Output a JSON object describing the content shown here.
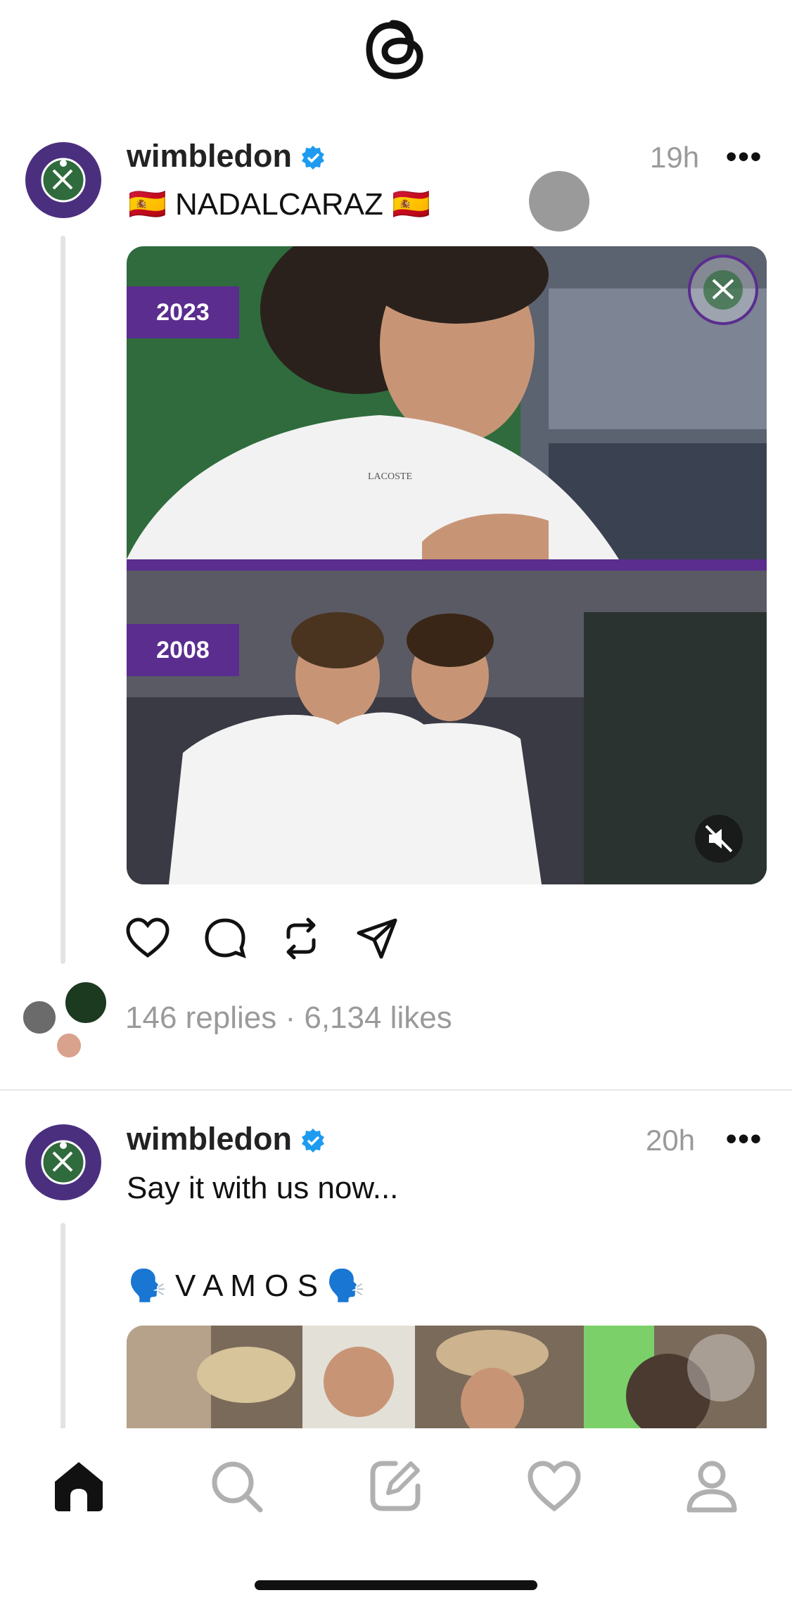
{
  "app": {
    "logo_icon": "threads-logo-icon"
  },
  "posts": [
    {
      "username": "wimbledon",
      "verified": true,
      "time": "19h",
      "more_label": "•••",
      "caption": "🇪🇸 NADALCARAZ 🇪🇸",
      "media": {
        "badge_top": "2023",
        "badge_bottom": "2008",
        "logo_text": "LACOSTE",
        "mute_icon": "speaker-muted-icon"
      },
      "stats": "146 replies · 6,134 likes",
      "actions": [
        "like-icon",
        "comment-icon",
        "repost-icon",
        "share-icon"
      ]
    },
    {
      "username": "wimbledon",
      "verified": true,
      "time": "20h",
      "more_label": "•••",
      "caption_line1": "Say it with us now...",
      "caption_line2": "🗣️ V A M O S 🗣️"
    }
  ],
  "nav": [
    "home-icon",
    "search-icon",
    "compose-icon",
    "activity-heart-icon",
    "profile-icon"
  ],
  "colors": {
    "brand_purple": "#4b2f7f",
    "verified_blue": "#1d9bf0",
    "grass_green": "#2f6b3c"
  }
}
